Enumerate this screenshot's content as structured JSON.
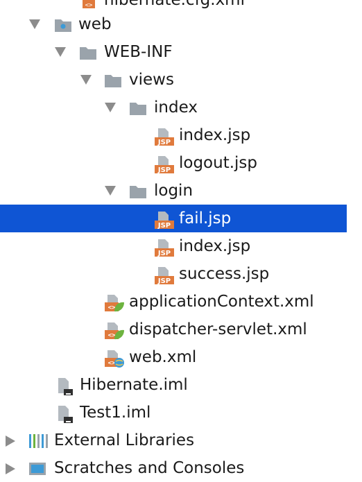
{
  "tree": {
    "top_partial": {
      "label": "hibernate.cfg.xml"
    },
    "web": {
      "label": "web"
    },
    "web_inf": {
      "label": "WEB-INF"
    },
    "views": {
      "label": "views"
    },
    "index_folder": {
      "label": "index"
    },
    "index_jsp": {
      "label": "index.jsp"
    },
    "logout_jsp": {
      "label": "logout.jsp"
    },
    "login_folder": {
      "label": "login"
    },
    "fail_jsp": {
      "label": "fail.jsp"
    },
    "login_index_jsp": {
      "label": "index.jsp"
    },
    "success_jsp": {
      "label": "success.jsp"
    },
    "application_context": {
      "label": "applicationContext.xml"
    },
    "dispatcher_servlet": {
      "label": "dispatcher-servlet.xml"
    },
    "web_xml": {
      "label": "web.xml"
    },
    "hibernate_iml": {
      "label": "Hibernate.iml"
    },
    "test1_iml": {
      "label": "Test1.iml"
    },
    "external_libraries": {
      "label": "External Libraries"
    },
    "scratches": {
      "label": "Scratches and Consoles"
    }
  },
  "icons": {
    "jsp_badge_text": "JSP",
    "folder_color": "#9aa3ab",
    "jsp_color": "#e07a3c",
    "xml_color": "#e07a3c",
    "spring_color": "#6db33f",
    "selection_color": "#0f55d4"
  }
}
